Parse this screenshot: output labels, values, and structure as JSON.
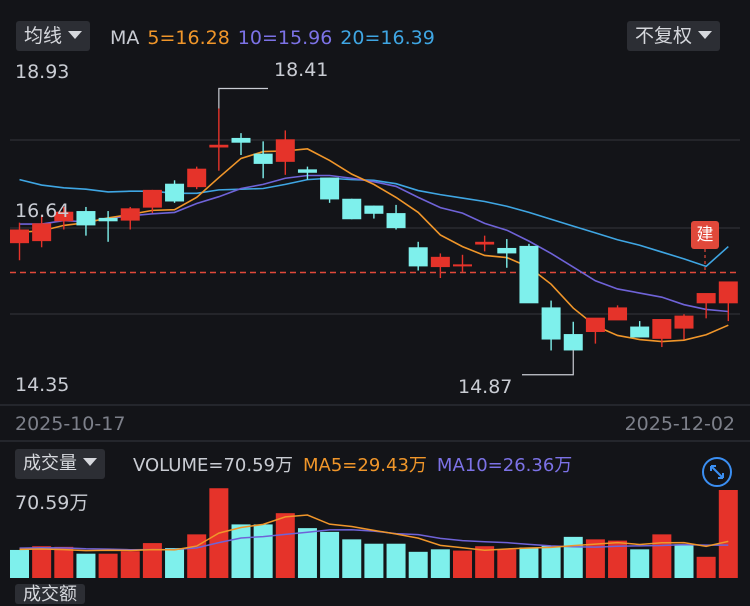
{
  "colors": {
    "up": "#e5332a",
    "down": "#7ef0ec",
    "ma5": "#f0962a",
    "ma10": "#6f63d8",
    "ma20": "#3fa6e3",
    "ref": "#e0483a",
    "grid": "#34363d"
  },
  "toolbar": {
    "avg_button": "均线",
    "rights_button": "不复权"
  },
  "ma_legend": {
    "label": "MA",
    "ma5": "5=16.28",
    "ma10": "10=15.96",
    "ma20": "20=16.39"
  },
  "axis": {
    "y_top": "18.93",
    "y_mid": "16.64",
    "y_bottom": "14.35",
    "x_start": "2025-10-17",
    "x_end": "2025-12-02"
  },
  "annotations": {
    "high": "18.41",
    "low": "14.87",
    "jian_badge": "建"
  },
  "volume_legend": {
    "button": "成交量",
    "volume": "VOLUME=70.59万",
    "ma5": "MA5=29.43万",
    "ma10": "MA10=26.36万",
    "y_top": "70.59万"
  },
  "bottom_tab": "成交额",
  "chart_data": [
    {
      "type": "candlestick",
      "ylim": [
        14.35,
        18.93
      ],
      "ohlc": [
        [
          16.44,
          16.74,
          16.19,
          16.64
        ],
        [
          16.47,
          16.85,
          16.38,
          16.73
        ],
        [
          16.76,
          16.97,
          16.64,
          16.9
        ],
        [
          16.91,
          16.97,
          16.55,
          16.7
        ],
        [
          16.81,
          16.91,
          16.46,
          16.76
        ],
        [
          16.77,
          16.97,
          16.64,
          16.95
        ],
        [
          16.96,
          17.22,
          16.88,
          17.22
        ],
        [
          17.31,
          17.36,
          17.03,
          17.05
        ],
        [
          17.26,
          17.56,
          17.23,
          17.53
        ],
        [
          17.84,
          18.41,
          17.5,
          17.88
        ],
        [
          17.98,
          18.05,
          17.73,
          17.91
        ],
        [
          17.75,
          17.93,
          17.39,
          17.6
        ],
        [
          17.63,
          18.09,
          17.44,
          17.96
        ],
        [
          17.52,
          17.56,
          17.37,
          17.47
        ],
        [
          17.4,
          17.4,
          17.03,
          17.08
        ],
        [
          17.09,
          17.09,
          16.79,
          16.79
        ],
        [
          16.99,
          16.99,
          16.8,
          16.87
        ],
        [
          16.88,
          17.0,
          16.64,
          16.66
        ],
        [
          16.38,
          16.46,
          16.04,
          16.1
        ],
        [
          16.09,
          16.29,
          15.93,
          16.24
        ],
        [
          16.1,
          16.27,
          16.02,
          16.13
        ],
        [
          16.42,
          16.55,
          16.32,
          16.46
        ],
        [
          16.37,
          16.5,
          16.08,
          16.29
        ],
        [
          16.4,
          16.43,
          15.57,
          15.56
        ],
        [
          15.5,
          15.6,
          14.87,
          15.03
        ],
        [
          15.11,
          15.29,
          14.88,
          14.87
        ],
        [
          15.14,
          15.29,
          14.97,
          15.35
        ],
        [
          15.31,
          15.53,
          15.33,
          15.5
        ],
        [
          15.22,
          15.3,
          15.06,
          15.06
        ],
        [
          15.04,
          15.28,
          14.92,
          15.33
        ],
        [
          15.19,
          15.4,
          15.03,
          15.38
        ],
        [
          15.56,
          15.65,
          15.34,
          15.71
        ],
        [
          15.56,
          15.57,
          15.3,
          15.88
        ]
      ],
      "ma_lines": {
        "ma5": [
          16.6,
          16.62,
          16.7,
          16.74,
          16.81,
          16.86,
          16.92,
          16.93,
          17.11,
          17.4,
          17.68,
          17.78,
          17.79,
          17.82,
          17.65,
          17.45,
          17.3,
          17.11,
          16.89,
          16.56,
          16.39,
          16.26,
          16.23,
          16.09,
          15.84,
          15.49,
          15.23,
          15.09,
          15.03,
          15.0,
          15.02,
          15.1,
          15.24
        ],
        "ma10": [
          16.72,
          16.72,
          16.77,
          16.75,
          16.8,
          16.84,
          16.87,
          16.89,
          17.02,
          17.12,
          17.24,
          17.3,
          17.39,
          17.43,
          17.43,
          17.39,
          17.34,
          17.27,
          17.11,
          16.96,
          16.88,
          16.73,
          16.63,
          16.47,
          16.29,
          16.09,
          15.89,
          15.77,
          15.71,
          15.65,
          15.54,
          15.47,
          15.44
        ],
        "ma20": [
          17.37,
          17.29,
          17.25,
          17.23,
          17.19,
          17.2,
          17.2,
          17.17,
          17.17,
          17.22,
          17.23,
          17.24,
          17.3,
          17.37,
          17.39,
          17.37,
          17.36,
          17.31,
          17.21,
          17.15,
          17.1,
          17.05,
          16.98,
          16.89,
          16.79,
          16.69,
          16.59,
          16.49,
          16.41,
          16.31,
          16.21,
          16.1,
          16.39
        ]
      },
      "ref_line": 16.01,
      "x_labels": [
        "2025-10-17",
        "2025-12-02"
      ]
    },
    {
      "type": "bar",
      "title": "成交量",
      "unit": "万",
      "ylim": [
        0,
        70.59
      ],
      "values": [
        22.5,
        25.5,
        25.0,
        19.5,
        19.5,
        21.5,
        28.0,
        24.0,
        35.0,
        72.0,
        43.0,
        43.0,
        52.0,
        40.0,
        37.0,
        31.0,
        27.5,
        27.5,
        21.0,
        23.0,
        22.0,
        25.5,
        23.0,
        24.5,
        26.0,
        33.0,
        31.0,
        30.0,
        23.0,
        35.0,
        27.0,
        17.0,
        70.59
      ],
      "up": [
        false,
        true,
        true,
        false,
        true,
        true,
        true,
        false,
        true,
        true,
        false,
        false,
        true,
        false,
        false,
        false,
        false,
        false,
        false,
        false,
        true,
        true,
        true,
        false,
        false,
        false,
        true,
        true,
        false,
        true,
        false,
        true,
        true
      ],
      "ma5": [
        23.0,
        23.3,
        22.8,
        22.0,
        22.3,
        22.1,
        22.8,
        22.6,
        25.6,
        36.0,
        40.5,
        43.0,
        49.0,
        50.5,
        43.2,
        41.3,
        38.2,
        35.3,
        32.0,
        26.2,
        24.3,
        22.3,
        23.3,
        24.1,
        24.6,
        26.0,
        27.2,
        28.4,
        26.9,
        28.3,
        28.4,
        25.4,
        29.4
      ],
      "ma10": [
        24.0,
        24.3,
        24.2,
        23.5,
        23.2,
        22.7,
        22.8,
        22.9,
        24.2,
        28.4,
        32.1,
        33.2,
        35.0,
        36.7,
        38.6,
        38.7,
        37.6,
        35.6,
        34.8,
        31.8,
        30.0,
        29.1,
        28.4,
        27.0,
        25.8,
        25.1,
        24.8,
        25.5,
        25.8,
        26.1,
        26.8,
        26.4,
        26.4
      ]
    }
  ]
}
